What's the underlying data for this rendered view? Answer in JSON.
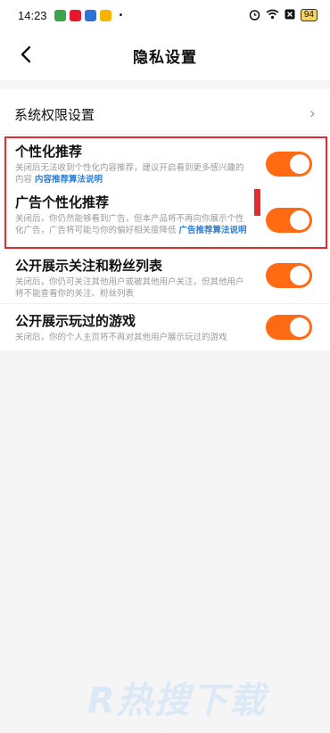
{
  "status_bar": {
    "time": "14:23",
    "app_icons": [
      {
        "name": "app-icon-green",
        "color": "#3aa54a"
      },
      {
        "name": "app-icon-weibo",
        "color": "#e6162d"
      },
      {
        "name": "app-icon-video",
        "color": "#2b73d6"
      },
      {
        "name": "app-icon-yellow",
        "color": "#f5b400"
      }
    ],
    "more": "•",
    "battery": "94"
  },
  "header": {
    "title": "隐私设置",
    "back_icon": "chevron-left-icon"
  },
  "system_permissions": {
    "label": "系统权限设置",
    "chevron": "›"
  },
  "settings": [
    {
      "title": "个性化推荐",
      "desc": "关闭后无法收到个性化内容推荐，建议开启看到更多感兴趣的内容 ",
      "link": "内容推荐算法说明",
      "enabled": true
    },
    {
      "title": "广告个性化推荐",
      "desc": "关闭后，你仍然能够看到广告，但本产品将不再向你展示个性化广告，广告将可能与你的偏好相关度降低 ",
      "link": "广告推荐算法说明",
      "enabled": true
    },
    {
      "title": "公开展示关注和粉丝列表",
      "desc": "关闭后，你仍可关注其他用户或被其他用户关注，但其他用户将不能查看你的关注、粉丝列表",
      "enabled": true
    },
    {
      "title": "公开展示玩过的游戏",
      "desc": "关闭后，你的个人主页将不再对其他用户展示玩过的游戏",
      "enabled": true
    }
  ],
  "colors": {
    "toggle_on": "#ff6a13",
    "link": "#2f7fd1",
    "highlight": "#e22a2f"
  },
  "watermark": "R热搜下载"
}
